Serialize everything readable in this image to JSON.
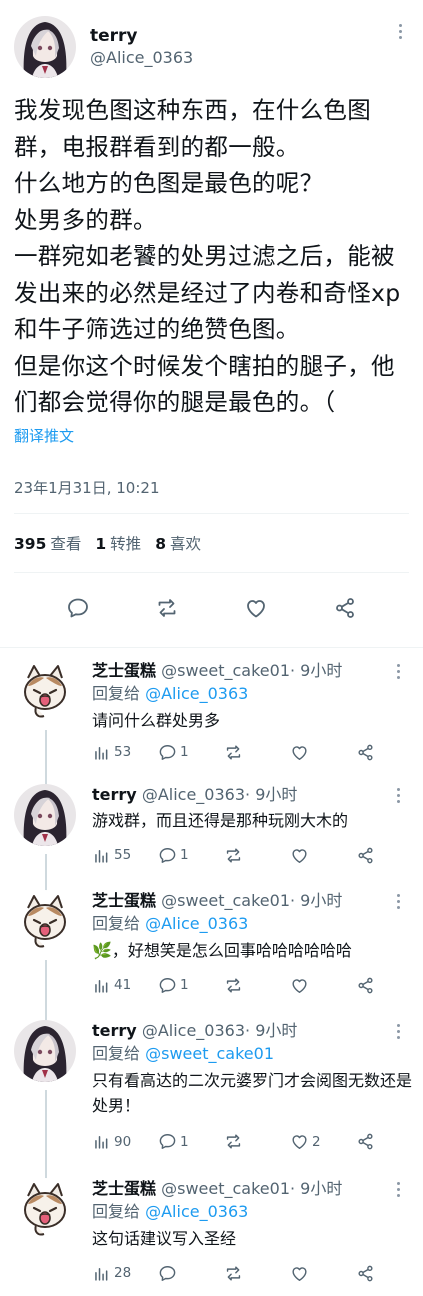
{
  "main_tweet": {
    "name": "terry",
    "handle": "@Alice_0363",
    "text": "我发现色图这种东西，在什么色图群，电报群看到的都一般。\n什么地方的色图是最色的呢？\n处男多的群。\n一群宛如老饕的处男过滤之后，能被发出来的必然是经过了内卷和奇怪xp和牛子筛选过的绝赞色图。\n但是你这个时候发个瞎拍的腿子，他们都会觉得你的腿是最色的。（",
    "translate_label": "翻译推文",
    "timestamp": "23年1月31日, 10:21",
    "stats": {
      "views_count": "395",
      "views_label": "查看",
      "retweets_count": "1",
      "retweets_label": "转推",
      "likes_count": "8",
      "likes_label": "喜欢"
    }
  },
  "replies": [
    {
      "name": "芝士蛋糕",
      "handle": "@sweet_cake01",
      "time": "· 9小时",
      "replying_prefix": "回复给",
      "replying_to": "@Alice_0363",
      "text": "请问什么群处男多",
      "views": "53",
      "replies": "1",
      "retweets": "",
      "likes": ""
    },
    {
      "name": "terry",
      "handle": "@Alice_0363",
      "time": "· 9小时",
      "replying_prefix": "",
      "replying_to": "",
      "text": "游戏群，而且还得是那种玩刚大木的",
      "views": "55",
      "replies": "1",
      "retweets": "",
      "likes": ""
    },
    {
      "name": "芝士蛋糕",
      "handle": "@sweet_cake01",
      "time": "· 9小时",
      "replying_prefix": "回复给",
      "replying_to": "@Alice_0363",
      "text": "🌿，好想笑是怎么回事哈哈哈哈哈哈",
      "views": "41",
      "replies": "1",
      "retweets": "",
      "likes": ""
    },
    {
      "name": "terry",
      "handle": "@Alice_0363",
      "time": "· 9小时",
      "replying_prefix": "回复给",
      "replying_to": "@sweet_cake01",
      "text": "只有看高达的二次元婆罗门才会阅图无数还是处男！",
      "views": "90",
      "replies": "1",
      "retweets": "",
      "likes": "2"
    },
    {
      "name": "芝士蛋糕",
      "handle": "@sweet_cake01",
      "time": "· 9小时",
      "replying_prefix": "回复给",
      "replying_to": "@Alice_0363",
      "text": "这句话建议写入圣经",
      "views": "28",
      "replies": "",
      "retweets": "",
      "likes": ""
    }
  ],
  "icons": [
    "more-icon",
    "reply-icon",
    "retweet-icon",
    "like-icon",
    "share-icon",
    "views-icon"
  ],
  "colors": {
    "accent": "#1d9bf0",
    "secondary_text": "#536471",
    "divider": "#eff3f4",
    "thread_line": "#cfd9de"
  }
}
